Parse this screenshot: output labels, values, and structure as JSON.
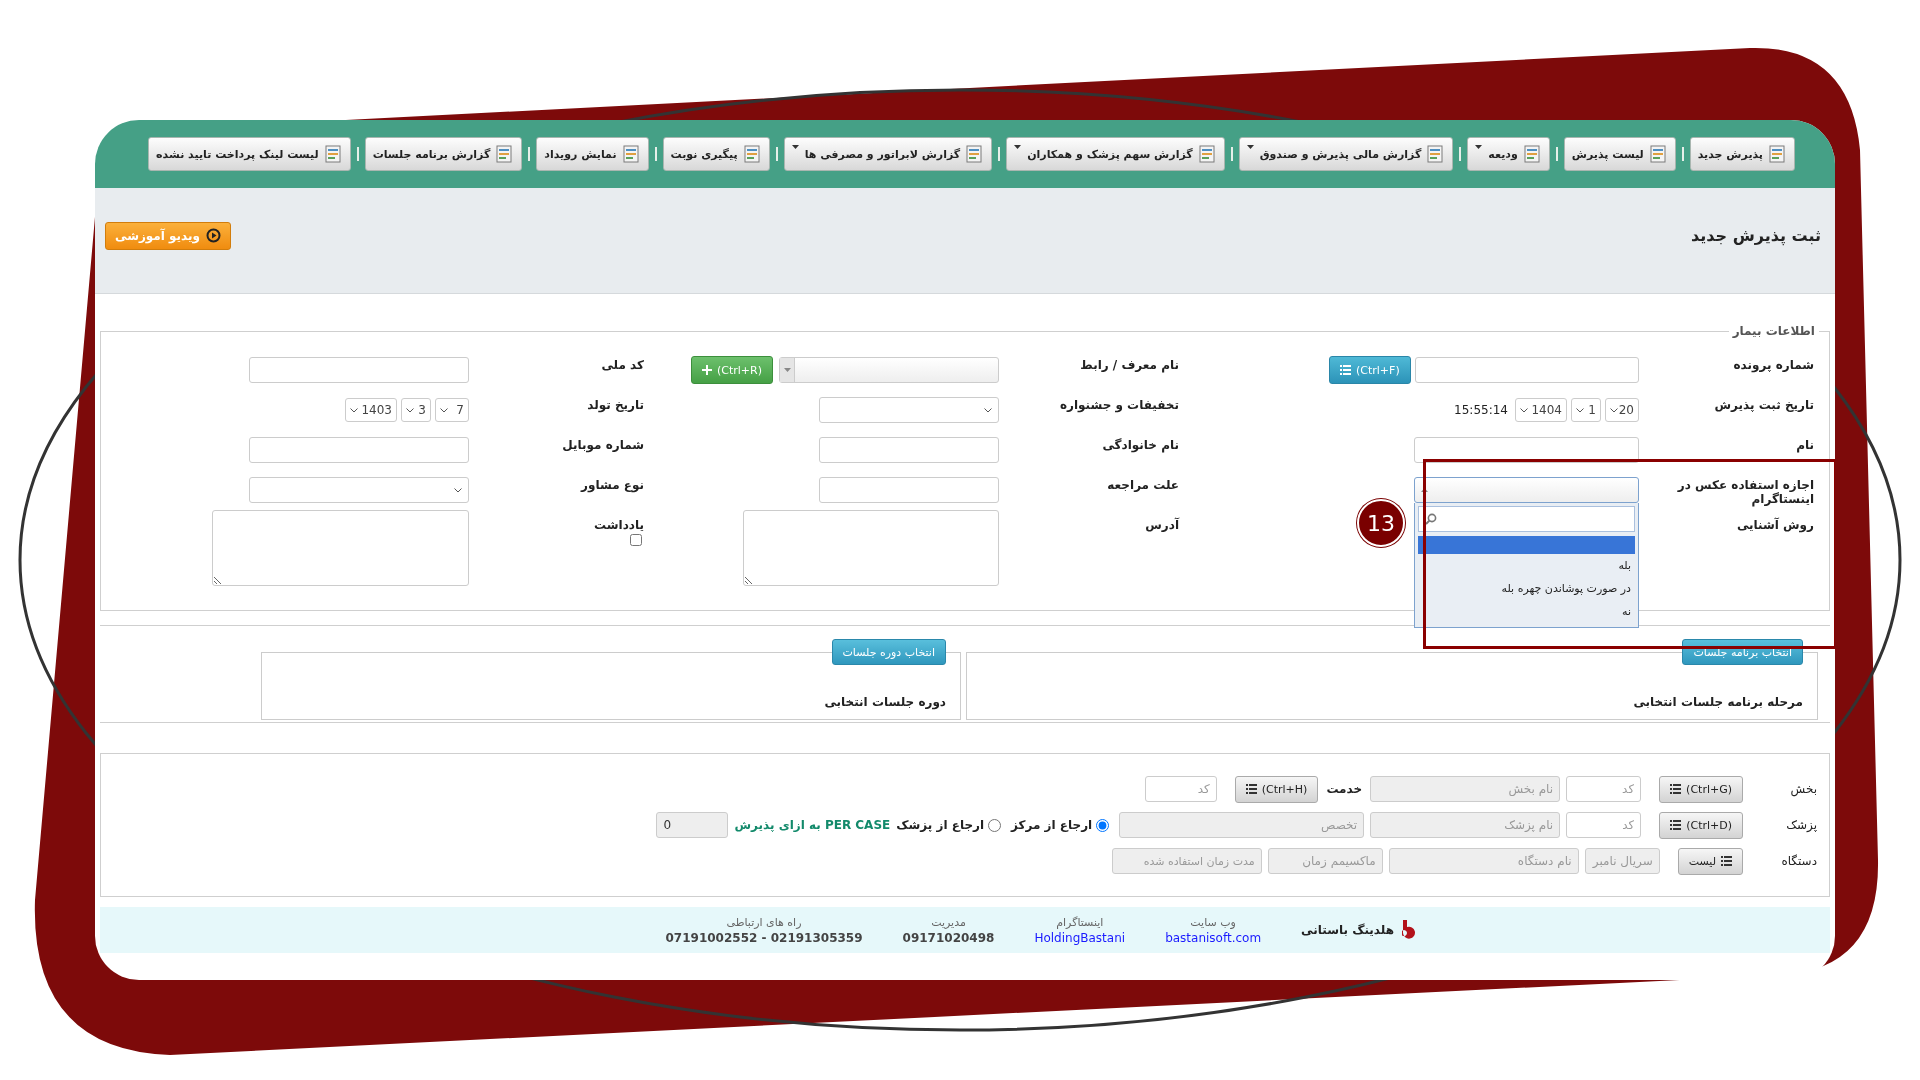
{
  "toolbar": [
    {
      "label": "پذیرش جدید",
      "dropdown": false
    },
    {
      "label": "لیست پذیرش",
      "dropdown": false
    },
    {
      "label": "ودیعه",
      "dropdown": true
    },
    {
      "label": "گزارش مالی پذیرش و صندوق",
      "dropdown": true
    },
    {
      "label": "گزارش سهم پزشک و همکاران",
      "dropdown": true
    },
    {
      "label": "گزارش لابراتور و مصرفی ها",
      "dropdown": true
    },
    {
      "label": "پیگیری نوبت",
      "dropdown": false
    },
    {
      "label": "نمایش رویداد",
      "dropdown": false
    },
    {
      "label": "گزارش برنامه جلسات",
      "dropdown": false
    },
    {
      "label": "لیست لینک پرداخت تایید نشده",
      "dropdown": false
    }
  ],
  "page_title": "ثبت پذیرش جدید",
  "video_button": "ویدیو آموزشی",
  "patient_info": {
    "legend": "اطلاعات بیمار",
    "file_number": {
      "label": "شماره پرونده",
      "button": "(Ctrl+F)"
    },
    "referrer": {
      "label": "نام معرف / رابط",
      "button": "(Ctrl+R)"
    },
    "national_code": {
      "label": "کد ملی"
    },
    "admission_date": {
      "label": "تاریخ ثبت پذیرش",
      "day": "20",
      "month": "1",
      "year": "1404",
      "time": "15:55:14"
    },
    "discounts": {
      "label": "تخفیفات و جشنواره"
    },
    "birth_date": {
      "label": "تاریخ تولد",
      "day": "7",
      "month": "3",
      "year": "1403"
    },
    "first_name": {
      "label": "نام"
    },
    "last_name": {
      "label": "نام خانوادگی"
    },
    "mobile": {
      "label": "شماره موبایل"
    },
    "photo_permission": {
      "label": "اجازه استفاده عکس در اینستاگرام",
      "expanded": true,
      "options": [
        {
          "highlighted": true
        },
        {
          "label": "بله",
          "highlighted": false
        },
        {
          "label": "در صورت پوشاندن چهره بله",
          "highlighted": false
        },
        {
          "label": "نه",
          "highlighted": false
        }
      ]
    },
    "visit_reason": {
      "label": "علت مراجعه"
    },
    "counselor_type": {
      "label": "نوع مشاور"
    },
    "acquaintance": {
      "label": "روش آشنایی"
    },
    "address": {
      "label": "آدرس"
    },
    "note": {
      "label": "یادداشت",
      "checked": false
    }
  },
  "annotation": {
    "number": "13"
  },
  "sessions": [
    {
      "button": "انتخاب برنامه جلسات",
      "label": "مرحله برنامه جلسات انتخابی"
    },
    {
      "button": "انتخاب دوره جلسات",
      "label": "دوره جلسات انتخابی"
    }
  ],
  "services": {
    "department": {
      "label": "بخش",
      "button": "(Ctrl+G)",
      "code": {
        "placeholder": "کد"
      },
      "name": {
        "placeholder": "نام بخش"
      },
      "service_label": "خدمت",
      "service_button": "(Ctrl+H)",
      "service_code": {
        "placeholder": "کد"
      }
    },
    "doctor": {
      "label": "پزشک",
      "button": "(Ctrl+D)",
      "code": {
        "placeholder": "کد"
      },
      "name": {
        "placeholder": "نام پزشک"
      },
      "specialty": {
        "placeholder": "تخصص"
      },
      "referrals": [
        {
          "label": "ارجاع از مرکز",
          "selected": true
        },
        {
          "label": "ارجاع از پزشک",
          "selected": false
        }
      ],
      "per_case": "PER CASE به ازای پذیرش",
      "per_case_value": "0"
    },
    "device": {
      "label": "دستگاه",
      "button": "لیست",
      "fields": [
        {
          "placeholder": "سریال نامبر"
        },
        {
          "placeholder": "نام دستگاه"
        },
        {
          "placeholder": "ماکسیمم زمان"
        },
        {
          "placeholder": "مدت زمان استفاده شده"
        }
      ]
    }
  },
  "footer": {
    "brand": "هلدینگ باستانی",
    "contacts": [
      {
        "title": "وب سایت",
        "value": "bastanisoft.com",
        "link": true
      },
      {
        "title": "اینستاگرام",
        "value": "HoldingBastani",
        "link": true
      },
      {
        "title": "مدیریت",
        "value": "09171020498",
        "link": false
      },
      {
        "title": "راه های ارتباطی",
        "value": "07191002552 - 02191305359",
        "link": false
      }
    ]
  }
}
